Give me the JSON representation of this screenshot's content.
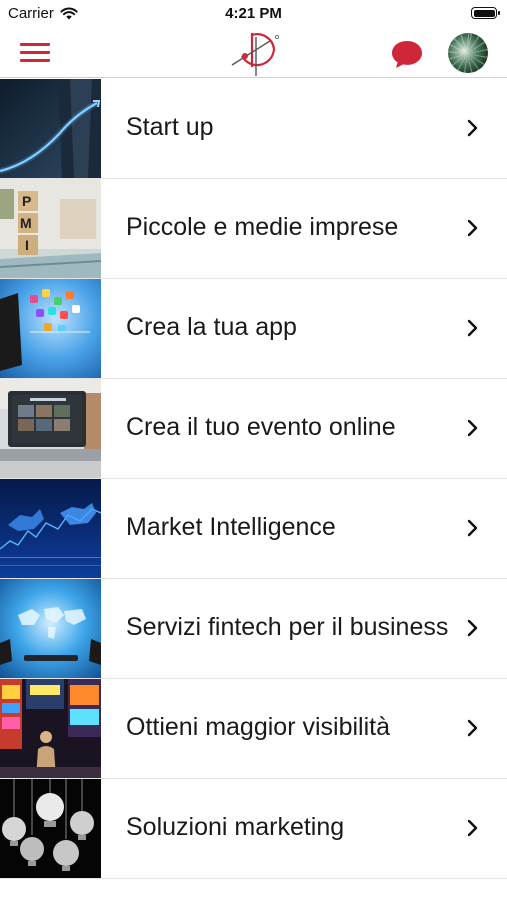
{
  "status_bar": {
    "carrier": "Carrier",
    "time": "4:21 PM"
  },
  "nav": {
    "menu_icon": "hamburger-menu-icon",
    "logo_icon": "brand-logo-icon",
    "chat_icon": "chat-bubble-icon",
    "avatar_icon": "profile-avatar",
    "accent_color": "#d0263a"
  },
  "menu": {
    "items": [
      {
        "label": "Start up",
        "thumbnail": "businessman-growth-chart"
      },
      {
        "label": "Piccole e medie imprese",
        "thumbnail": "pmi-wooden-blocks",
        "thumb_text": [
          "P",
          "M",
          "I"
        ]
      },
      {
        "label": "Crea la tua app",
        "thumbnail": "smartphone-app-icons"
      },
      {
        "label": "Crea il tuo evento online",
        "thumbnail": "laptop-video-conference"
      },
      {
        "label": "Market Intelligence",
        "thumbnail": "bull-bear-market"
      },
      {
        "label": "Servizi fintech per il business",
        "thumbnail": "world-map-hologram"
      },
      {
        "label": "Ottieni maggior visibilità",
        "thumbnail": "times-square-billboards"
      },
      {
        "label": "Soluzioni marketing",
        "thumbnail": "marketing-lightbulbs"
      }
    ]
  }
}
